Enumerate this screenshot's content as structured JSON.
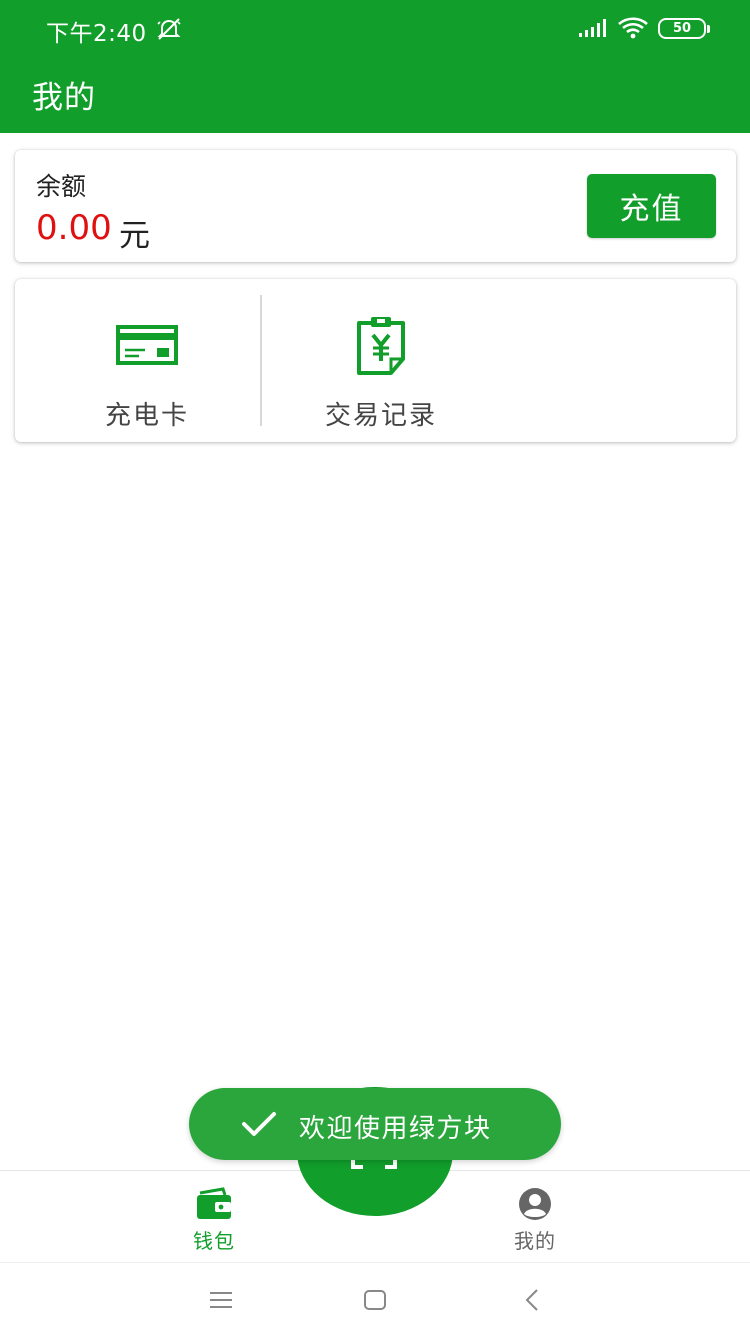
{
  "status_bar": {
    "time": "下午2:40",
    "battery": "50",
    "icons": [
      "mute-icon",
      "signal-icon",
      "wifi-icon",
      "battery-icon"
    ]
  },
  "app_bar": {
    "title": "我的"
  },
  "balance": {
    "label": "余额",
    "amount": "0.00",
    "unit": "元",
    "recharge_label": "充值"
  },
  "menu": {
    "items": [
      {
        "label": "充电卡",
        "icon": "charging-card-icon"
      },
      {
        "label": "交易记录",
        "icon": "transaction-record-icon"
      }
    ]
  },
  "toast": {
    "text": "欢迎使用绿方块",
    "icon": "check-icon"
  },
  "bottom_nav": {
    "items": [
      {
        "label": "钱包",
        "icon": "wallet-icon",
        "active": true
      },
      {
        "label": "我的",
        "icon": "account-icon",
        "active": false
      }
    ],
    "center_button_icon": "scan-icon"
  },
  "colors": {
    "primary": "#119e2a",
    "toast": "#2aa63c",
    "amount": "#e01010",
    "inactive": "#666666"
  }
}
